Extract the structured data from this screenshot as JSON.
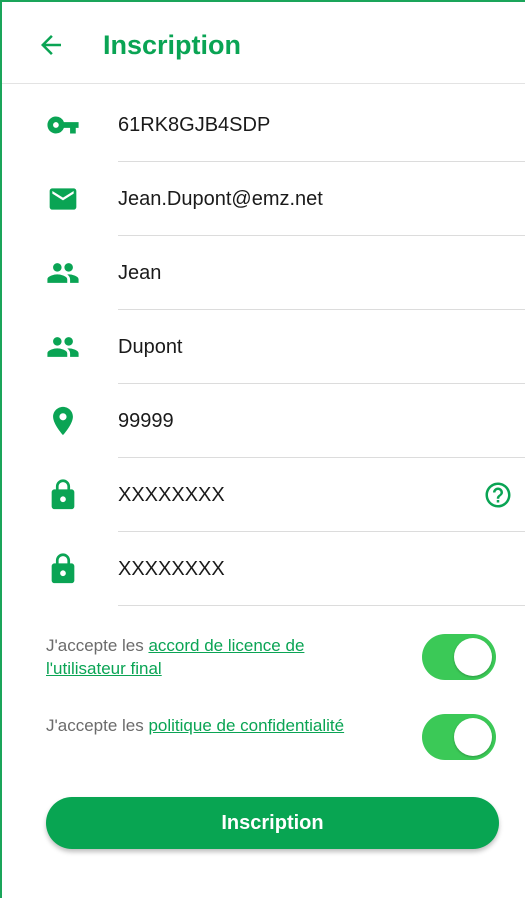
{
  "colors": {
    "accent": "#0aa454",
    "toggle_on": "#3bc957"
  },
  "header": {
    "title": "Inscription",
    "back_icon": "arrow-left-icon"
  },
  "fields": [
    {
      "icon": "key-icon",
      "value": "61RK8GJB4SDP"
    },
    {
      "icon": "email-icon",
      "value": "Jean.Dupont@emz.net"
    },
    {
      "icon": "people-icon",
      "value": "Jean"
    },
    {
      "icon": "people-icon",
      "value": "Dupont"
    },
    {
      "icon": "location-pin-icon",
      "value": "99999"
    },
    {
      "icon": "lock-icon",
      "value": "XXXXXXXX",
      "help_icon": "help-circle-icon"
    },
    {
      "icon": "lock-icon",
      "value": "XXXXXXXX"
    }
  ],
  "consents": [
    {
      "prefix": "J'accepte les ",
      "link": "accord de licence de l'utilisateur final",
      "checked": true
    },
    {
      "prefix": "J'accepte les ",
      "link": "politique de confidentialité",
      "checked": true
    }
  ],
  "submit_label": "Inscription"
}
